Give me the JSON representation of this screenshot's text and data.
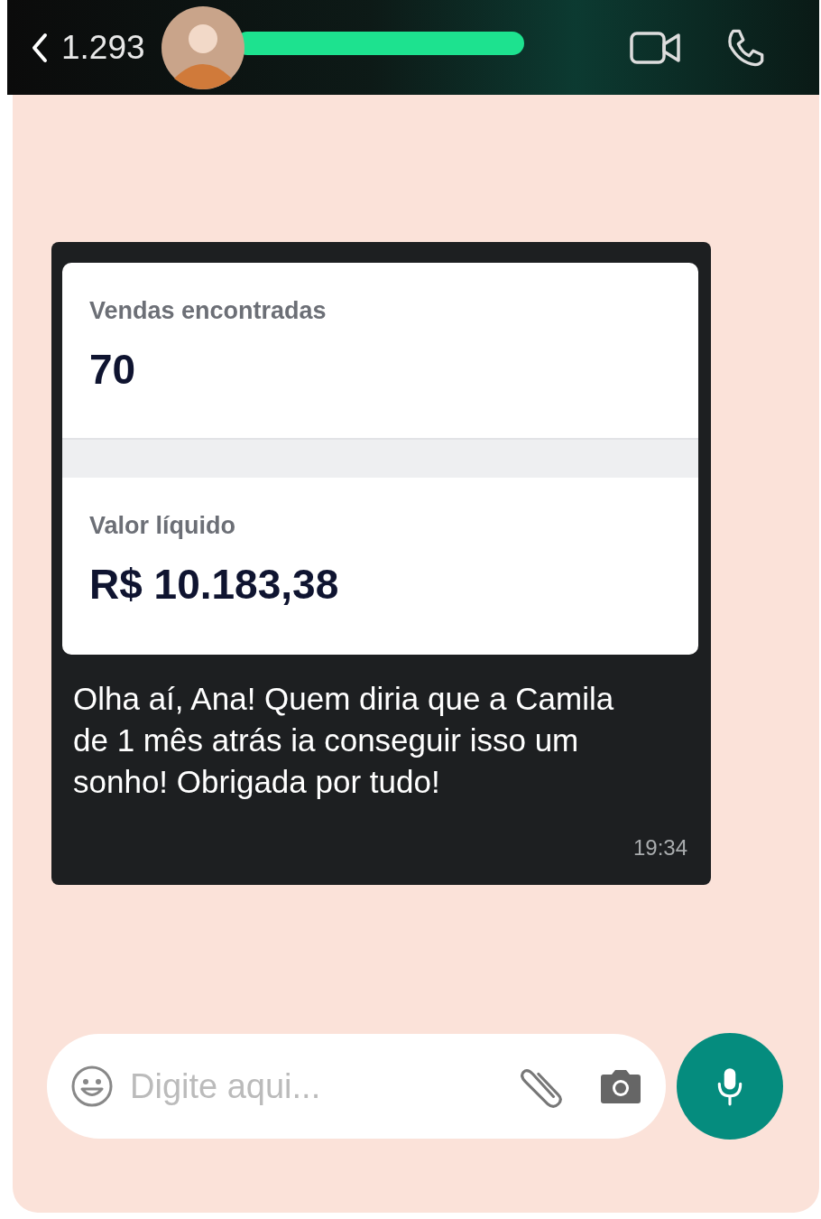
{
  "header": {
    "unread_count": "1.293"
  },
  "message": {
    "stats": [
      {
        "label": "Vendas encontradas",
        "value": "70"
      },
      {
        "label": "Valor líquido",
        "value": "R$ 10.183,38"
      }
    ],
    "text": "Olha aí, Ana! Quem diria que a Camila de 1 mês atrás ia conseguir isso um sonho! Obrigada por tudo!",
    "time": "19:34"
  },
  "composer": {
    "placeholder": "Digite aqui..."
  }
}
